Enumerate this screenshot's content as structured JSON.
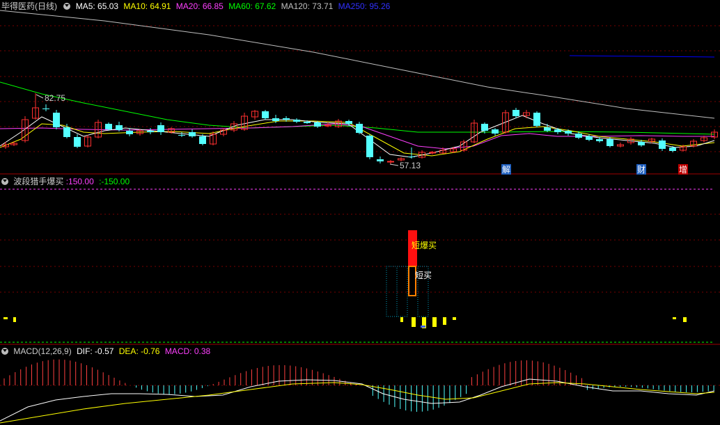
{
  "colors": {
    "background": "#000000",
    "up": "#ff3030",
    "down": "#54ffff",
    "ma5": "#ffffff",
    "ma10": "#ffff00",
    "ma20": "#ff40ff",
    "ma60": "#00ff00",
    "ma120": "#c0c0c0",
    "ma250": "#0000ff"
  },
  "main_panel": {
    "title": "毕得医药(日线)",
    "ma5": "MA5: 65.03",
    "ma10": "MA10: 64.91",
    "ma20": "MA20: 66.85",
    "ma60": "MA60: 67.62",
    "ma120": "MA120: 73.71",
    "ma250": "MA250: 95.26",
    "high_marker": "82.75",
    "low_marker": "57.13",
    "events": [
      "解",
      "财",
      "增"
    ]
  },
  "indicator_panel": {
    "title": "波段猎手爆买",
    "val1": ":150.00",
    "val2": ":-150.00",
    "signal_strong": "短爆买",
    "signal_weak": "短买"
  },
  "macd_panel": {
    "title": "MACD(12,26,9)",
    "dif": "DIF: -0.57",
    "dea": "DEA: -0.76",
    "macd": "MACD: 0.38"
  }
}
